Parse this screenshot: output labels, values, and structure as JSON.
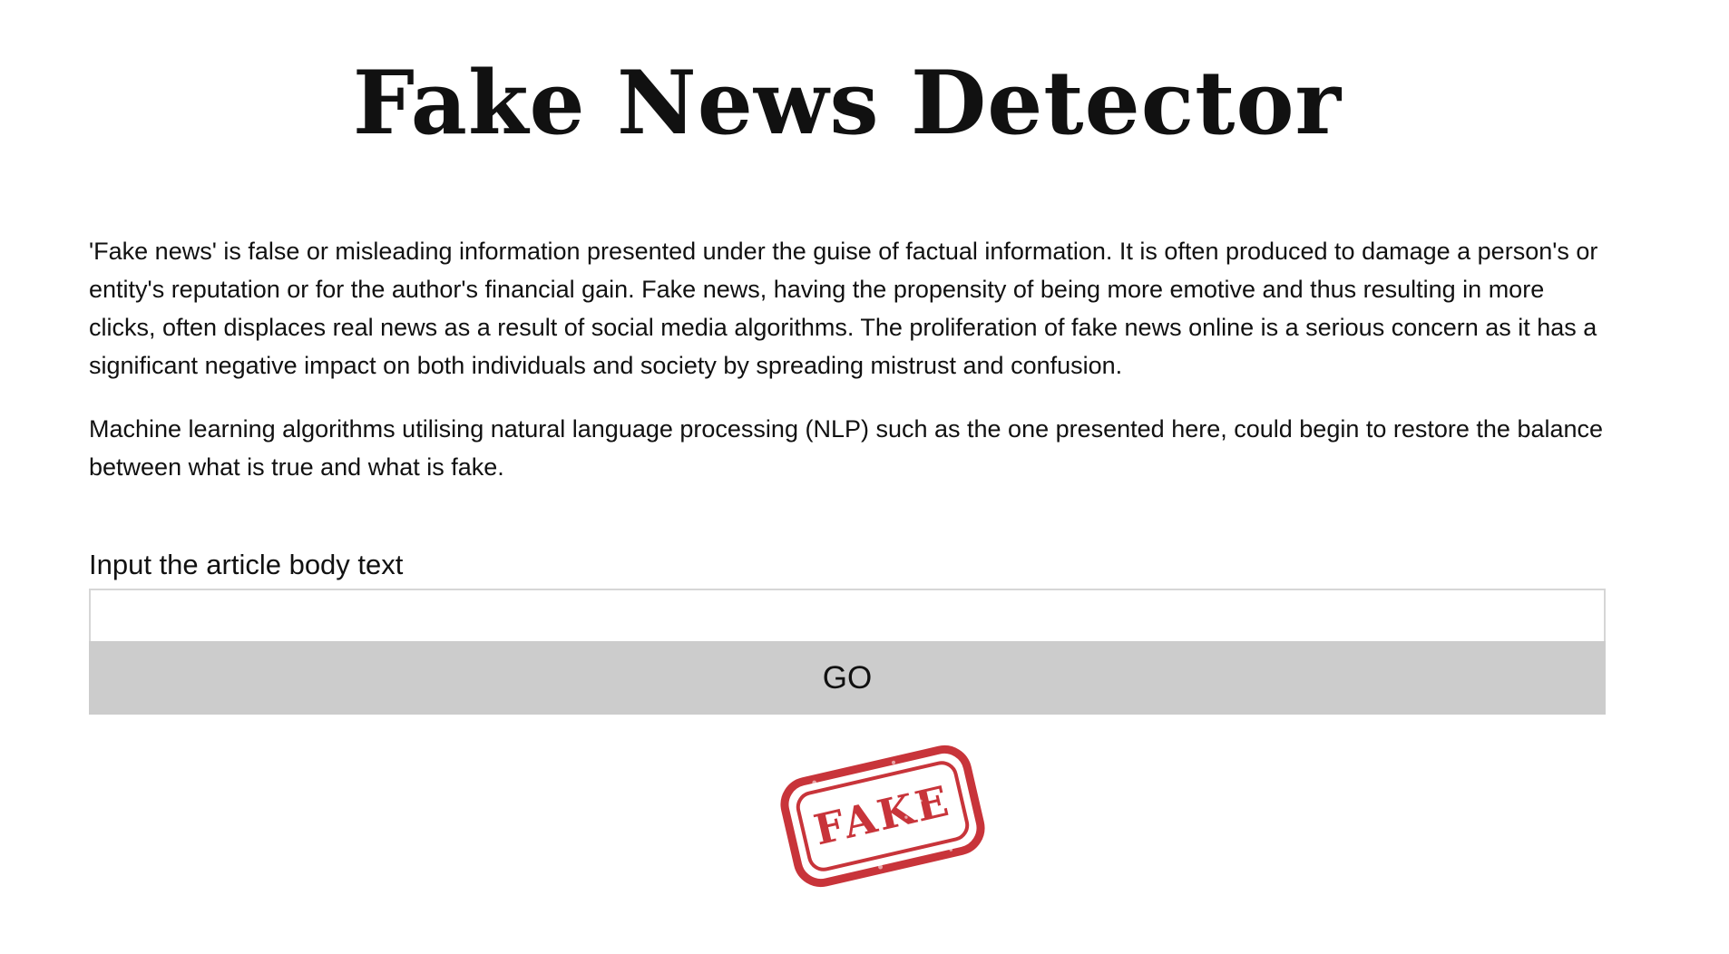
{
  "page": {
    "title": "Fake News Detector"
  },
  "intro": {
    "paragraphs": [
      "'Fake news' is false or misleading information presented under the guise of factual information. It is often produced to damage a person's or entity's reputation or for the author's financial gain. Fake news, having the propensity of being more emotive and thus resulting in more clicks, often displaces real news as a result of social media algorithms. The proliferation of fake news online is a serious concern as it has a significant negative impact on both individuals and society by spreading mistrust and confusion.",
      "Machine learning algorithms utilising natural language processing (NLP) such as the one presented here, could begin to restore the balance between what is true and what is fake."
    ]
  },
  "form": {
    "label": "Input the article body text",
    "value": "",
    "go_label": "GO"
  },
  "result": {
    "stamp_text": "FAKE",
    "stamp_icon": "fake-stamp-icon",
    "stamp_color": "#c8343a"
  },
  "colors": {
    "button_bg": "#cccccc",
    "input_border": "#d6d6d6",
    "text": "#111111"
  }
}
